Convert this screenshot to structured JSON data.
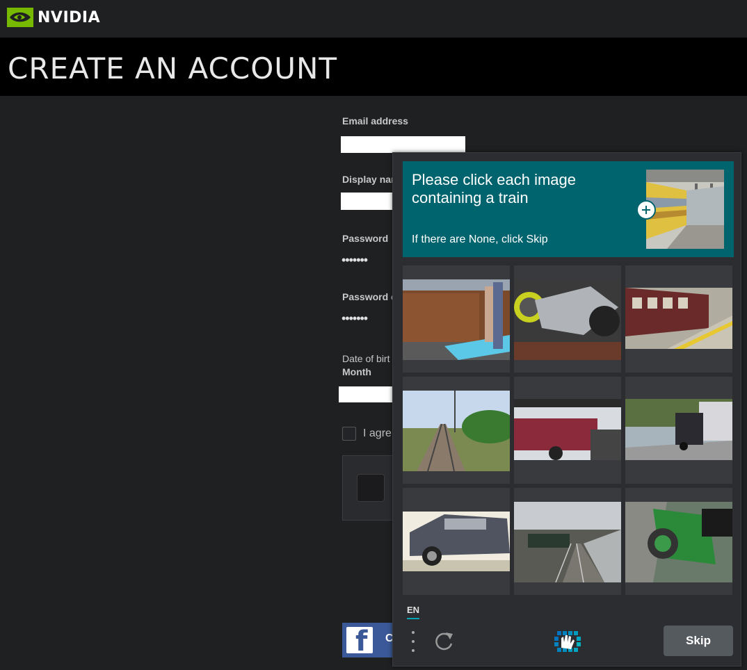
{
  "brand": {
    "name": "NVIDIA",
    "accent": "#76b900"
  },
  "header": {
    "title": "CREATE AN ACCOUNT"
  },
  "form": {
    "email_label": "Email address",
    "display_name_label": "Display nar",
    "password_label": "Password",
    "password_value": "•••••••",
    "password_confirm_label": "Password c",
    "password_confirm_value": "•••••••",
    "dob_label": "Date of birt",
    "month_label": "Month",
    "agree_label": "I agre",
    "facebook_label": "C"
  },
  "captcha": {
    "prompt": "Please click each image containing a train",
    "hint": "If there are None, click Skip",
    "language": "EN",
    "skip_label": "Skip",
    "prompt_bg": "#00646e",
    "tiles": [
      "freight-train-platform",
      "motorcycle-wheel",
      "subway-train-station",
      "railway-tracks",
      "truck-street",
      "truck-highway",
      "sedan-car",
      "railway-tracks-tunnel",
      "green-scooter"
    ]
  }
}
